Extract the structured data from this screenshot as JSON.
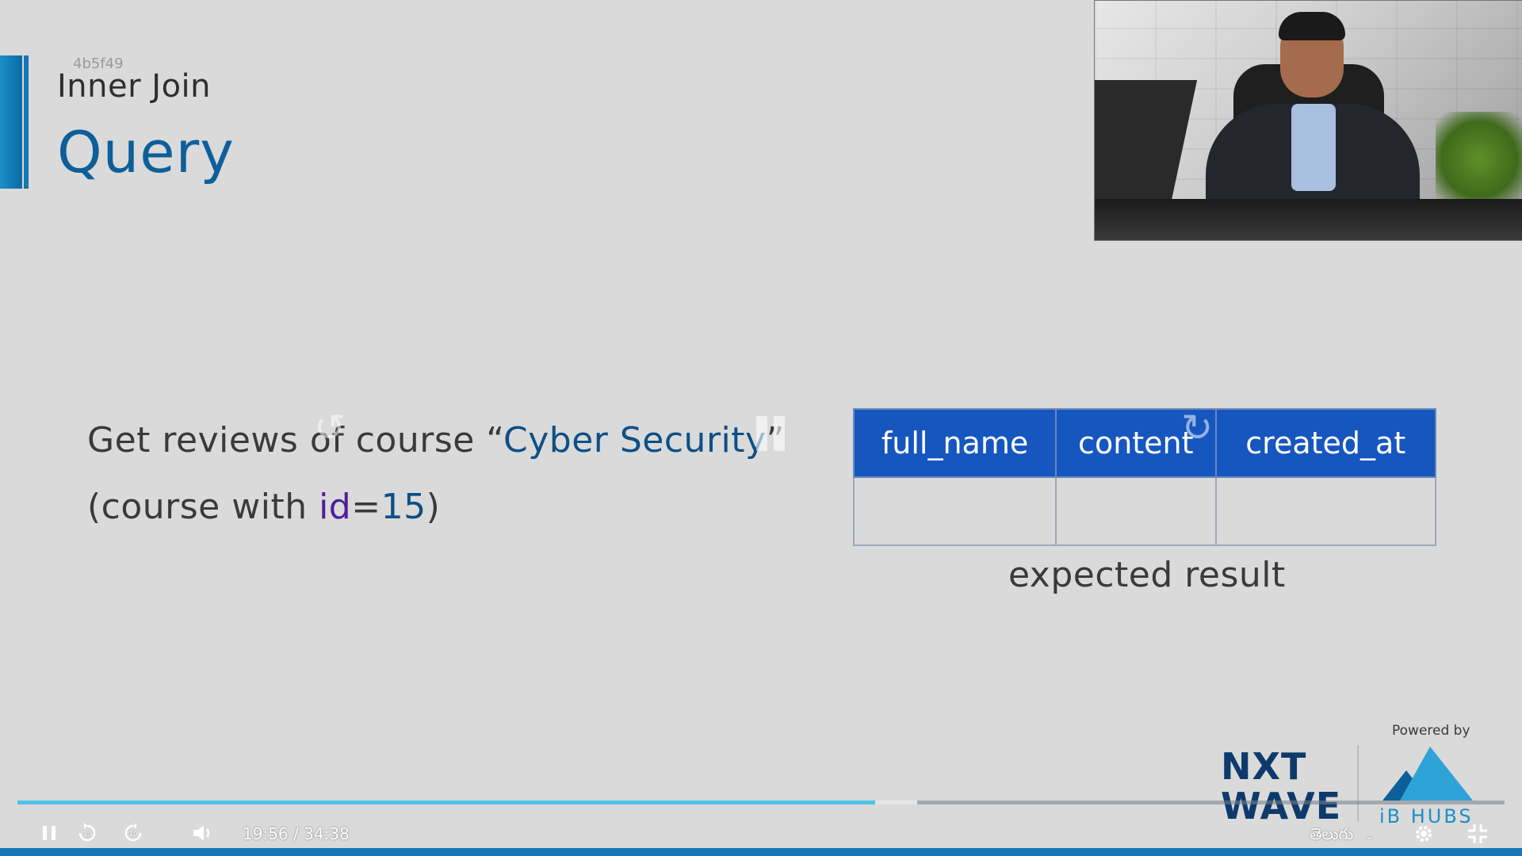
{
  "slide": {
    "hash": "4b5f49",
    "subtitle": "Inner Join",
    "title": "Query",
    "prompt": {
      "line1_prefix": "Get reviews of course “",
      "line1_course": "Cyber Security",
      "line1_suffix": "”",
      "line2_open": "(course with ",
      "line2_key": "id",
      "line2_eq": "=",
      "line2_value": "15",
      "line2_close": ")"
    },
    "table": {
      "headers": [
        "full_name",
        "content",
        "created_at"
      ],
      "rows": [
        [
          "",
          "",
          ""
        ]
      ]
    },
    "caption": "expected result"
  },
  "branding": {
    "powered_by": "Powered by",
    "nxt_line1": "NXT",
    "nxt_line2": "WAVE",
    "ib_hubs": "iB HUBS"
  },
  "player": {
    "current_time": "19:56",
    "separator": "/",
    "duration": "34:38",
    "progress_fraction": 0.577,
    "buffered_fraction": 0.605,
    "language": "తెలుగు",
    "icons": {
      "play_pause": "pause-icon",
      "rewind": "rewind-10-icon",
      "forward": "forward-10-icon",
      "volume": "volume-icon",
      "settings": "gear-icon",
      "exit_fullscreen": "exit-fullscreen-icon"
    }
  },
  "colors": {
    "title_blue": "#0d5f9a",
    "table_header": "#1656bf",
    "progress": "#4fc3e8",
    "highlight_purple": "#4d1f9a"
  }
}
